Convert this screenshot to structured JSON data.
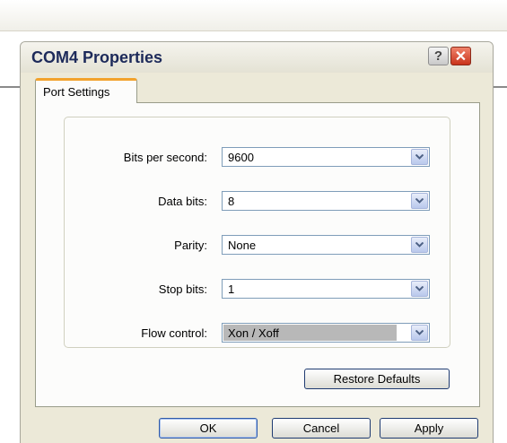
{
  "dialog": {
    "title": "COM4 Properties",
    "help_glyph": "?",
    "close_glyph": "✕"
  },
  "tabs": [
    {
      "label": "Port Settings",
      "active": true
    }
  ],
  "fields": [
    {
      "label": "Bits per second:",
      "value": "9600"
    },
    {
      "label": "Data bits:",
      "value": "8"
    },
    {
      "label": "Parity:",
      "value": "None"
    },
    {
      "label": "Stop bits:",
      "value": "1"
    },
    {
      "label": "Flow control:",
      "value": "Xon / Xoff"
    }
  ],
  "buttons": {
    "restore": "Restore Defaults",
    "ok": "OK",
    "cancel": "Cancel",
    "apply": "Apply"
  },
  "icons": {
    "help": "help-icon",
    "close": "close-icon",
    "dropdown": "chevron-down-icon"
  },
  "colors": {
    "dialog_bg": "#ece9d8",
    "tab_accent": "#f2a22c",
    "close_red": "#c9331b",
    "title_text": "#1d2a5a"
  }
}
